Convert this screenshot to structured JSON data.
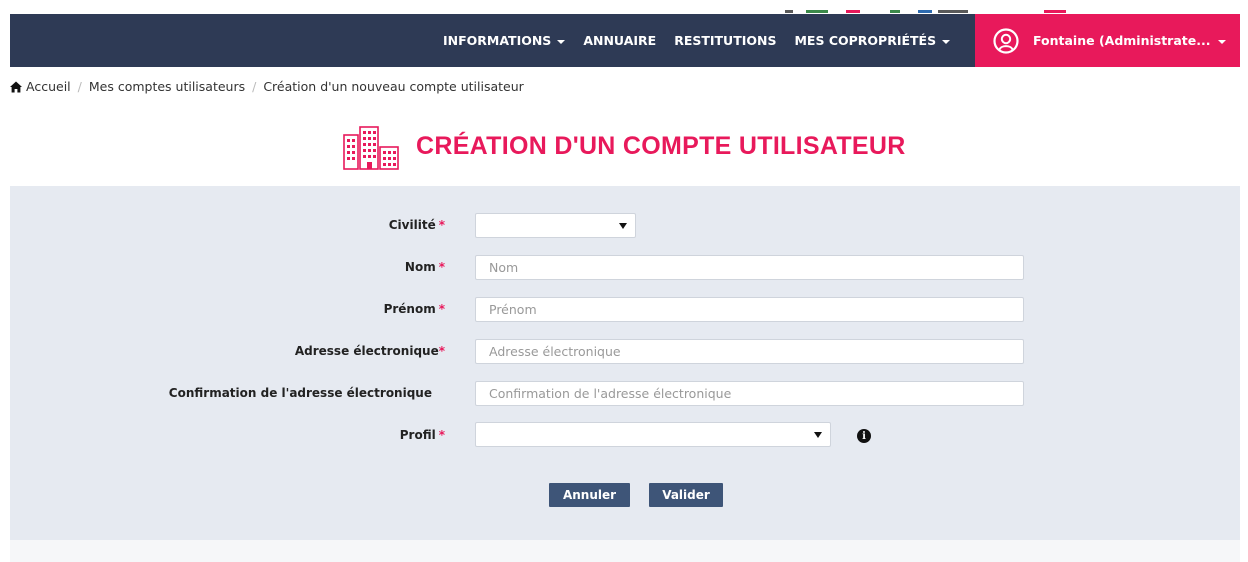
{
  "nav": {
    "items": [
      {
        "label": "INFORMATIONS",
        "has_caret": true
      },
      {
        "label": "ANNUAIRE",
        "has_caret": false
      },
      {
        "label": "RESTITUTIONS",
        "has_caret": false
      },
      {
        "label": "MES COPROPRIÉTÉS",
        "has_caret": true
      }
    ],
    "user_label": "Fontaine (Administrate...",
    "user_icon": "user-circle-icon"
  },
  "breadcrumb": {
    "home": "Accueil",
    "level2": "Mes comptes utilisateurs",
    "current": "Création d'un nouveau compte utilisateur",
    "separator": "/"
  },
  "page_title": "CRÉATION D'UN COMPTE UTILISATEUR",
  "form": {
    "civilite_label": "Civilité",
    "nom_label": "Nom",
    "nom_placeholder": "Nom",
    "prenom_label": "Prénom",
    "prenom_placeholder": "Prénom",
    "email_label": "Adresse électronique",
    "email_placeholder": "Adresse électronique",
    "email_confirm_label": "Confirmation de l'adresse électronique",
    "email_confirm_placeholder": "Confirmation de l'adresse électronique",
    "profil_label": "Profil",
    "required_marker": "*",
    "info_glyph": "i"
  },
  "buttons": {
    "cancel": "Annuler",
    "submit": "Valider"
  },
  "colors": {
    "nav_bg": "#2e3a55",
    "accent": "#e8195b",
    "panel_bg": "#e6eaf1",
    "button_bg": "#3e5578"
  }
}
